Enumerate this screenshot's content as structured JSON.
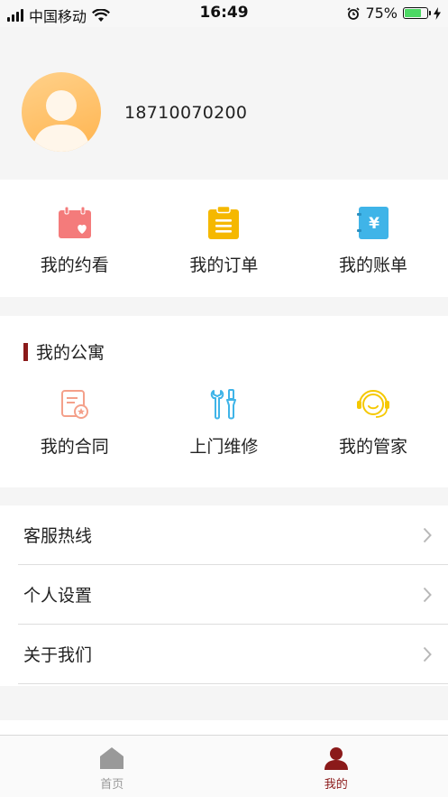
{
  "status_bar": {
    "carrier": "中国移动",
    "time": "16:49",
    "battery_percent_text": "75%",
    "battery_level": 0.75,
    "battery_color": "#4cd964"
  },
  "profile": {
    "phone": "18710070200",
    "avatar_icon": "user-avatar-icon",
    "avatar_color": "#ffb44f"
  },
  "quick_actions": [
    {
      "label": "我的约看",
      "icon": "calendar-heart-icon",
      "color": "#f47b7b"
    },
    {
      "label": "我的订单",
      "icon": "clipboard-icon",
      "color": "#f5b800"
    },
    {
      "label": "我的账单",
      "icon": "yuan-bill-icon",
      "color": "#3fb4e8"
    }
  ],
  "apartment": {
    "title": "我的公寓",
    "accent_color": "#8b1a1a",
    "items": [
      {
        "label": "我的合同",
        "icon": "contract-icon",
        "color": "#f4a08a"
      },
      {
        "label": "上门维修",
        "icon": "repair-tools-icon",
        "color": "#3fb4e8"
      },
      {
        "label": "我的管家",
        "icon": "butler-headset-icon",
        "color": "#f5c800"
      }
    ]
  },
  "menu": [
    {
      "label": "客服热线"
    },
    {
      "label": "个人设置"
    },
    {
      "label": "关于我们"
    }
  ],
  "tabs": [
    {
      "label": "首页",
      "icon": "home-icon",
      "active": false,
      "color": "#999999"
    },
    {
      "label": "我的",
      "icon": "user-icon",
      "active": true,
      "color": "#8b1a1a"
    }
  ]
}
